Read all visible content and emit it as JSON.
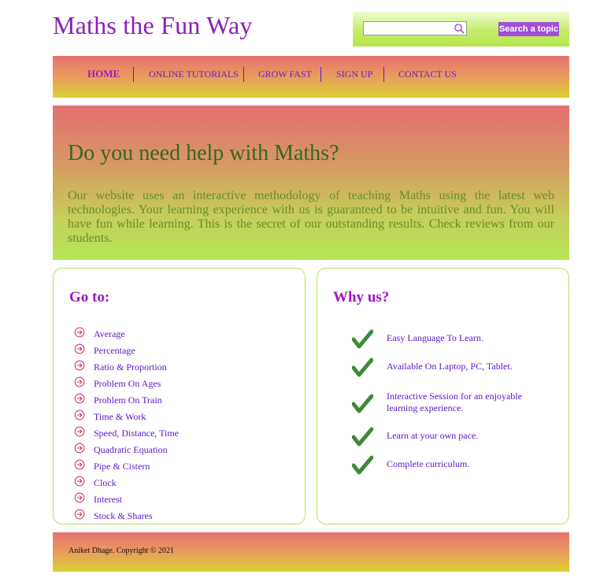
{
  "header": {
    "title": "Maths the Fun Way",
    "search": {
      "placeholder": "",
      "value": "",
      "button_label": "Search a topic"
    }
  },
  "nav": {
    "items": [
      {
        "label": "HOME",
        "active": true
      },
      {
        "label": "ONLINE TUTORIALS",
        "active": false
      },
      {
        "label": "GROW FAST",
        "active": false
      },
      {
        "label": "SIGN UP",
        "active": false
      },
      {
        "label": "CONTACT US",
        "active": false
      }
    ]
  },
  "hero": {
    "title": "Do you need help with Maths?",
    "text": "Our website uses an interactive methodology of teaching Maths using the latest web technologies. Your learning experience with us is guaranteed to be intuitive and fun. You will have fun while learning. This is the secret of our outstanding results. Check reviews from our students."
  },
  "goto": {
    "title": "Go to:",
    "icon": "circle-arrow-right-icon",
    "items": [
      "Average",
      "Percentage",
      "Ratio & Proportion",
      "Problem On Ages",
      "Problem On Train",
      "Time & Work",
      "Speed, Distance, Time",
      "Quadratic Equation",
      "Pipe & Cistern",
      "Clock",
      "Interest",
      "Stock & Shares"
    ]
  },
  "why": {
    "title": "Why us?",
    "icon": "checkmark-icon",
    "items": [
      "Easy Language To Learn.",
      "Available On Laptop, PC, Tablet.",
      "Interactive Session for an enjoyable learning experience.",
      "Learn at your own pace.",
      "Complete curriculum."
    ]
  },
  "footer": {
    "text": "Aniket Dhage. Copyright © 2021"
  },
  "colors": {
    "brand_purple": "#8b1fb8",
    "link": "#5a16c8",
    "hero_title": "#37681a",
    "accent_green": "#b5e656",
    "check_green": "#3f8a3a",
    "arrow_red": "#d8386a",
    "button": "#a24fd6"
  }
}
